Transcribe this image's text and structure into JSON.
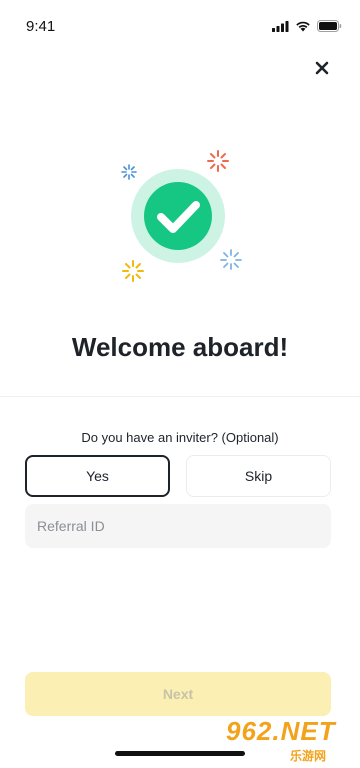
{
  "status_bar": {
    "time": "9:41"
  },
  "colors": {
    "accent_green": "#16c784",
    "halo_green": "#cdf3e4",
    "primary_yellow": "#fcd535"
  },
  "icons": {
    "close": "close-icon",
    "success": "checkmark-circle-icon",
    "signal": "cellular-signal-icon",
    "wifi": "wifi-icon",
    "battery": "battery-icon"
  },
  "main": {
    "title": "Welcome aboard!",
    "question": "Do you have an inviter? (Optional)",
    "yes_label": "Yes",
    "skip_label": "Skip",
    "referral_placeholder": "Referral ID",
    "next_label": "Next"
  },
  "watermark": {
    "top": "962.NET",
    "bottom": "乐游网"
  }
}
